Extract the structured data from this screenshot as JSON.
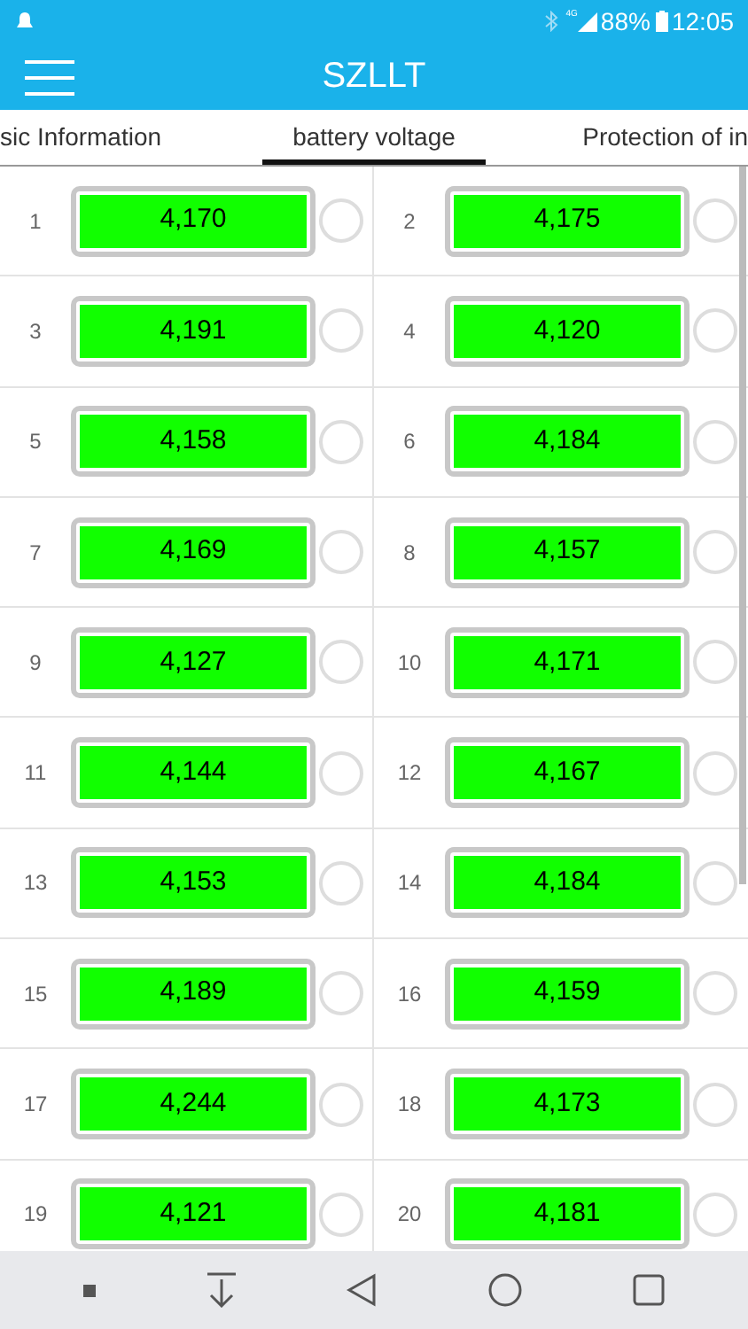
{
  "status_bar": {
    "network": "4G",
    "battery": "88%",
    "time": "12:05"
  },
  "header": {
    "title": "SZLLT"
  },
  "tabs": [
    {
      "label": "sic Information",
      "selected": false
    },
    {
      "label": "battery voltage",
      "selected": true
    },
    {
      "label": "Protection of in",
      "selected": false
    }
  ],
  "cells": [
    {
      "index": "1",
      "value": "4,170",
      "checked": false
    },
    {
      "index": "2",
      "value": "4,175",
      "checked": false
    },
    {
      "index": "3",
      "value": "4,191",
      "checked": false
    },
    {
      "index": "4",
      "value": "4,120",
      "checked": false
    },
    {
      "index": "5",
      "value": "4,158",
      "checked": false
    },
    {
      "index": "6",
      "value": "4,184",
      "checked": false
    },
    {
      "index": "7",
      "value": "4,169",
      "checked": false
    },
    {
      "index": "8",
      "value": "4,157",
      "checked": false
    },
    {
      "index": "9",
      "value": "4,127",
      "checked": false
    },
    {
      "index": "10",
      "value": "4,171",
      "checked": false
    },
    {
      "index": "11",
      "value": "4,144",
      "checked": false
    },
    {
      "index": "12",
      "value": "4,167",
      "checked": false
    },
    {
      "index": "13",
      "value": "4,153",
      "checked": false
    },
    {
      "index": "14",
      "value": "4,184",
      "checked": false
    },
    {
      "index": "15",
      "value": "4,189",
      "checked": false
    },
    {
      "index": "16",
      "value": "4,159",
      "checked": false
    },
    {
      "index": "17",
      "value": "4,244",
      "checked": false
    },
    {
      "index": "18",
      "value": "4,173",
      "checked": false
    },
    {
      "index": "19",
      "value": "4,121",
      "checked": false
    },
    {
      "index": "20",
      "value": "4,181",
      "checked": false
    }
  ]
}
